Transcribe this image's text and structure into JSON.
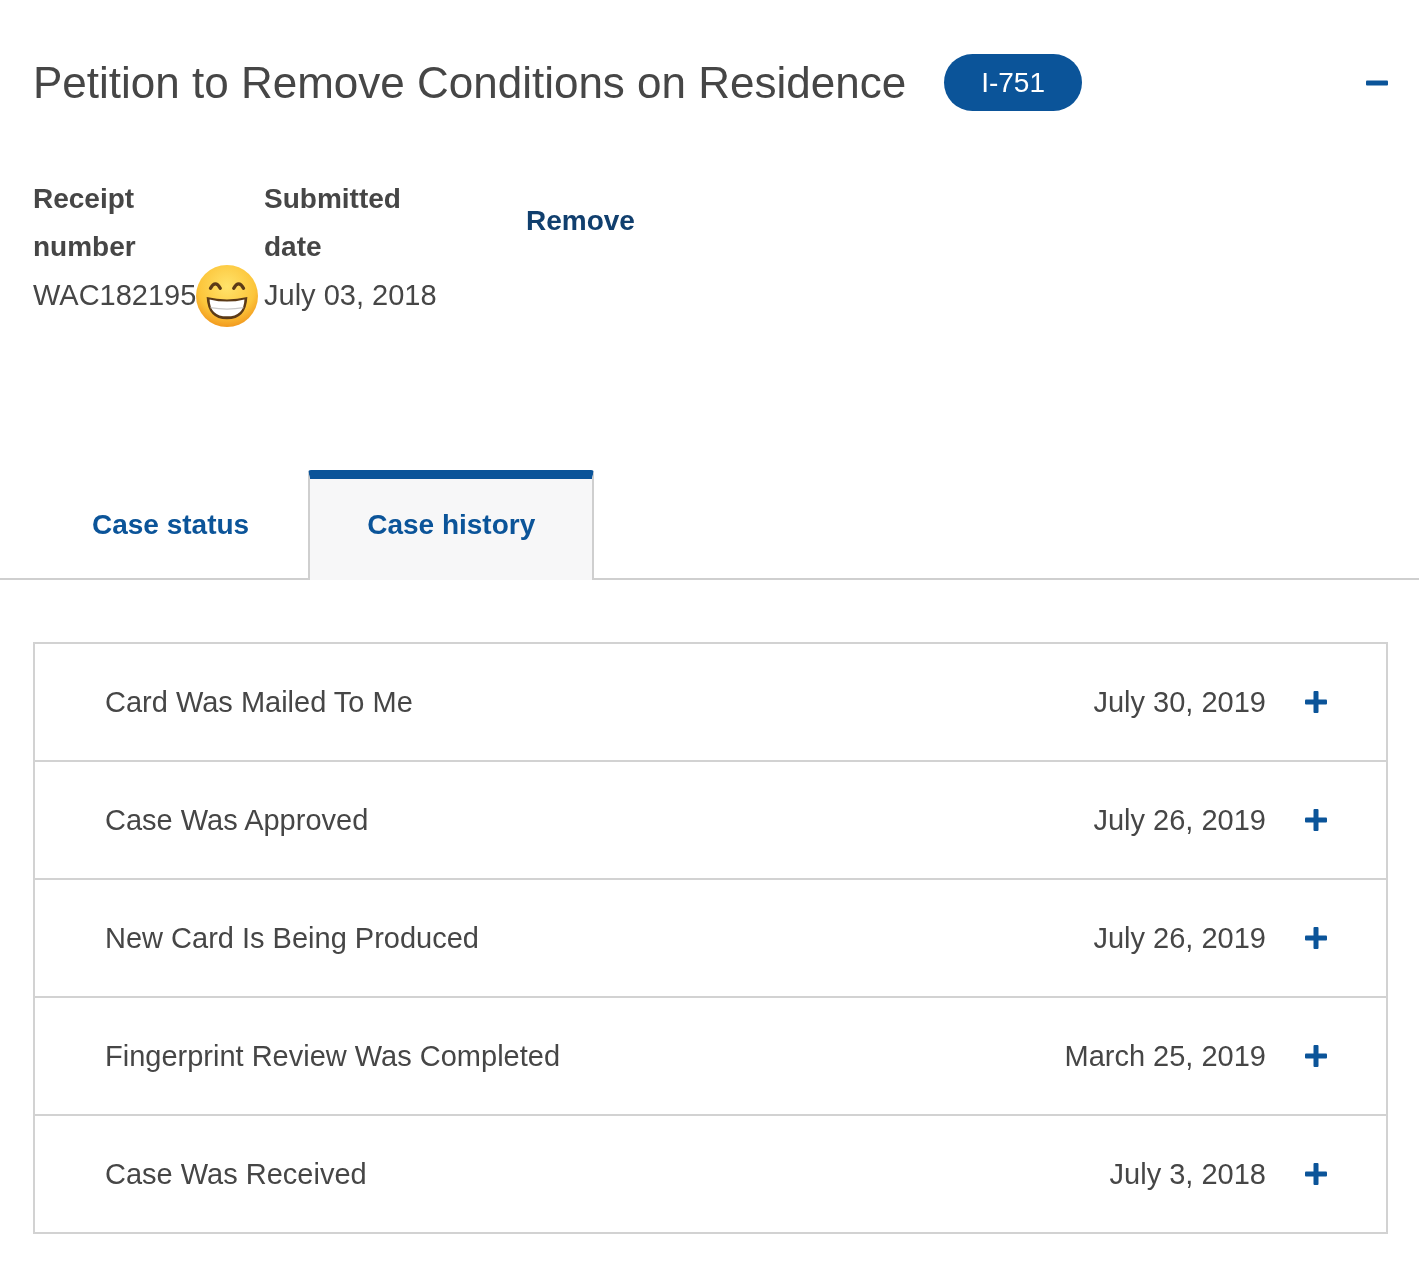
{
  "case": {
    "title": "Petition to Remove Conditions on Residence",
    "form_badge": "I-751",
    "expanded": true
  },
  "details": [
    {
      "label": "Receipt number",
      "value": "WAC182195",
      "redacted": true
    },
    {
      "label": "Submitted date",
      "value": "July 03, 2018",
      "redacted": false
    }
  ],
  "remove_link": "Remove",
  "tabs": [
    {
      "label": "Case status",
      "selected": false
    },
    {
      "label": "Case history",
      "selected": true
    }
  ],
  "history": [
    {
      "event": "Card Was Mailed To Me",
      "date": "July 30, 2019",
      "expanded": false
    },
    {
      "event": "Case Was Approved",
      "date": "July 26, 2019",
      "expanded": false
    },
    {
      "event": "New Card Is Being Produced",
      "date": "July 26, 2019",
      "expanded": false
    },
    {
      "event": "Fingerprint Review Was Completed",
      "date": "March 25, 2019",
      "expanded": false
    },
    {
      "event": "Case Was Received",
      "date": "July 3, 2018",
      "expanded": false
    }
  ]
}
